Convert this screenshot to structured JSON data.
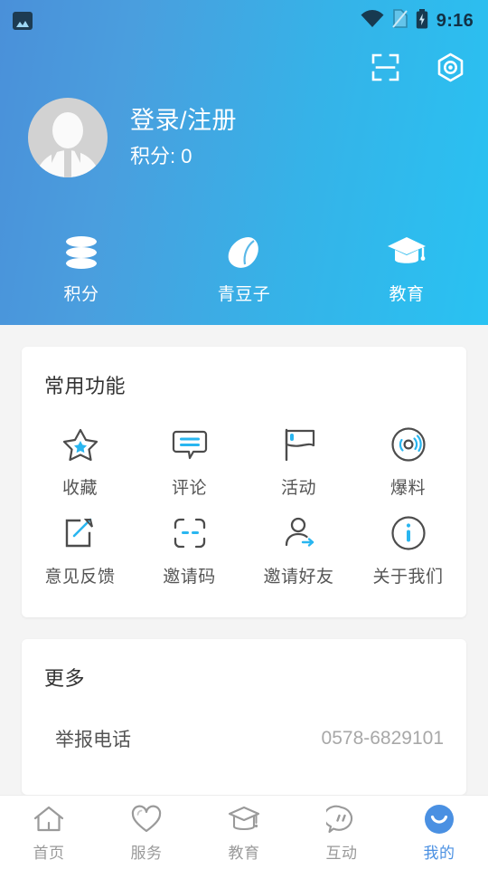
{
  "status_bar": {
    "time": "9:16",
    "icons": [
      "image-icon",
      "wifi-icon",
      "sim-card-icon",
      "battery-charging-icon"
    ]
  },
  "header": {
    "actions": [
      {
        "name": "scan-icon",
        "label": "扫一扫"
      },
      {
        "name": "settings-hexagon-icon",
        "label": "设置"
      }
    ],
    "profile": {
      "avatar": "default-avatar",
      "login_text": "登录/注册",
      "points_text": "积分: 0"
    },
    "quick_entries": [
      {
        "icon": "coins-stack-icon",
        "label": "积分"
      },
      {
        "icon": "bean-icon",
        "label": "青豆子"
      },
      {
        "icon": "graduation-cap-icon",
        "label": "教育"
      }
    ]
  },
  "functions_card": {
    "title": "常用功能",
    "items": [
      {
        "icon": "star-icon",
        "label": "收藏"
      },
      {
        "icon": "comment-bubble-icon",
        "label": "评论"
      },
      {
        "icon": "flag-icon",
        "label": "活动"
      },
      {
        "icon": "broadcast-icon",
        "label": "爆料"
      },
      {
        "icon": "edit-square-icon",
        "label": "意见反馈"
      },
      {
        "icon": "invite-code-icon",
        "label": "邀请码"
      },
      {
        "icon": "invite-friend-icon",
        "label": "邀请好友"
      },
      {
        "icon": "info-circle-icon",
        "label": "关于我们"
      }
    ]
  },
  "more_card": {
    "title": "更多",
    "rows": [
      {
        "label": "举报电话",
        "value": "0578-6829101"
      }
    ]
  },
  "tabbar": {
    "items": [
      {
        "icon": "home-icon",
        "label": "首页",
        "active": false
      },
      {
        "icon": "heart-icon",
        "label": "服务",
        "active": false
      },
      {
        "icon": "graduation-cap-icon",
        "label": "教育",
        "active": false
      },
      {
        "icon": "chat-bubble-icon",
        "label": "互动",
        "active": false
      },
      {
        "icon": "smiley-face-icon",
        "label": "我的",
        "active": true
      }
    ]
  },
  "colors": {
    "header_gradient_start": "#4a90d9",
    "header_gradient_end": "#29c2f2",
    "accent_blue": "#29b6f0",
    "active_tab": "#4a90e2",
    "page_background": "#f4f4f4",
    "card_background": "#ffffff",
    "icon_gray": "#555555",
    "muted_text": "#a8a8a8"
  }
}
